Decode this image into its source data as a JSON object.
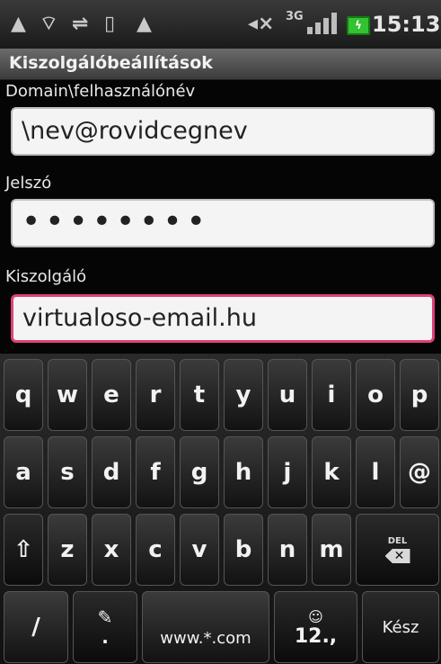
{
  "status_bar": {
    "icons": [
      "warning-icon",
      "wifi-question-icon",
      "usb-icon",
      "sim-icon",
      "warning-icon",
      "muted-speaker-icon"
    ],
    "network_type": "3G",
    "battery": "ϟ",
    "time": "15:13"
  },
  "title_bar": {
    "title": "Kiszolgálóbeállítások"
  },
  "form": {
    "username": {
      "label": "Domain\\felhasználónév",
      "value": "\\nev@rovidcegnev"
    },
    "password": {
      "label": "Jelszó",
      "value": "••••••••"
    },
    "server": {
      "label": "Kiszolgáló",
      "value": "virtualoso-email.hu"
    }
  },
  "keyboard": {
    "row1": [
      "q",
      "w",
      "e",
      "r",
      "t",
      "y",
      "u",
      "i",
      "o",
      "p"
    ],
    "row2": [
      "a",
      "s",
      "d",
      "f",
      "g",
      "h",
      "j",
      "k",
      "l",
      "@"
    ],
    "row3": [
      "z",
      "x",
      "c",
      "v",
      "b",
      "n",
      "m"
    ],
    "shift_label": "⇧",
    "del_label": "DEL",
    "slash": "/",
    "dot": ".",
    "pencil": "✎",
    "www": "www.*.com",
    "num_label": "12.,",
    "smiley": "☺",
    "done": "Kész"
  }
}
